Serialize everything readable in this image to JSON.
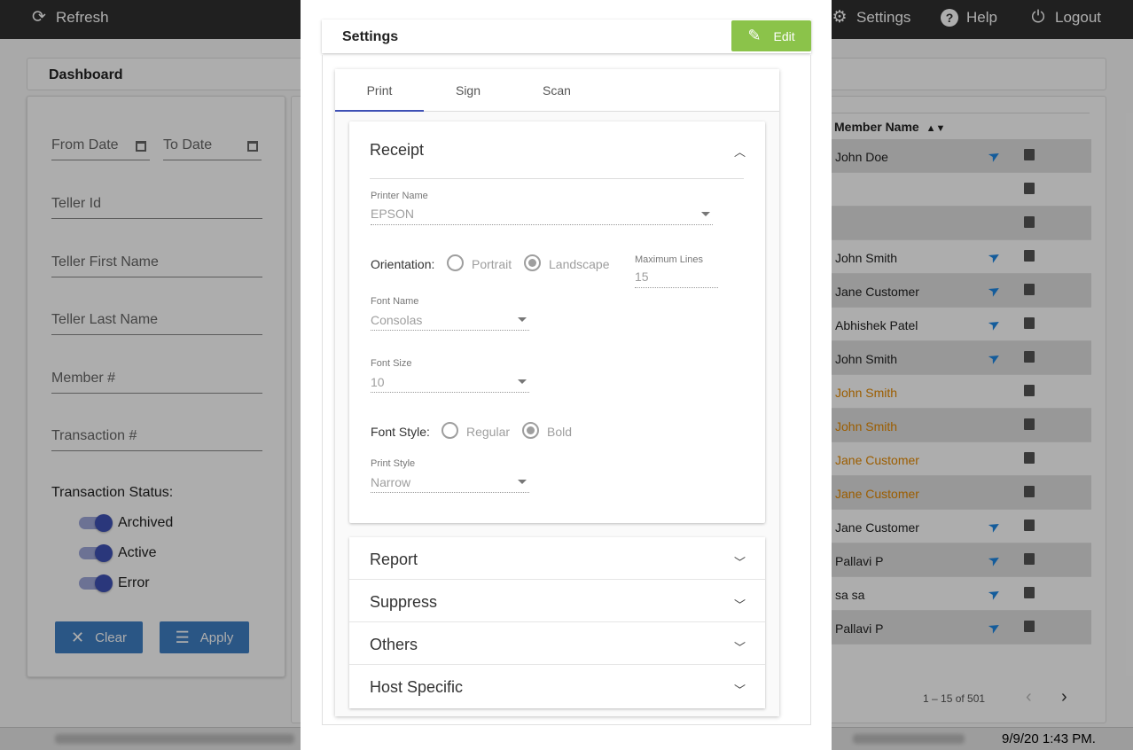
{
  "topbar": {
    "refresh": "Refresh",
    "settings": "Settings",
    "help": "Help",
    "logout": "Logout"
  },
  "dashboard": {
    "title": "Dashboard"
  },
  "filters": {
    "from_date": "From Date",
    "to_date": "To Date",
    "teller_id": "Teller Id",
    "teller_first_name": "Teller First Name",
    "teller_last_name": "Teller Last Name",
    "member_no": "Member #",
    "transaction_no": "Transaction #",
    "status_title": "Transaction Status:",
    "statuses": [
      "Archived",
      "Active",
      "Error"
    ],
    "clear": "Clear",
    "apply": "Apply"
  },
  "table": {
    "member_name_header": "Member Name",
    "rows": [
      {
        "name": "John Doe",
        "send": true,
        "warn": false
      },
      {
        "name": "",
        "send": false,
        "warn": false
      },
      {
        "name": "",
        "send": false,
        "warn": false
      },
      {
        "name": "John Smith",
        "send": true,
        "warn": false
      },
      {
        "name": "Jane Customer",
        "send": true,
        "warn": false
      },
      {
        "name": "Abhishek Patel",
        "send": true,
        "warn": false
      },
      {
        "name": "John Smith",
        "send": true,
        "warn": false
      },
      {
        "name": "John Smith",
        "send": false,
        "warn": true
      },
      {
        "name": "John Smith",
        "send": false,
        "warn": true
      },
      {
        "name": "Jane Customer",
        "send": false,
        "warn": true
      },
      {
        "name": "Jane Customer",
        "send": false,
        "warn": true
      },
      {
        "name": "Jane Customer",
        "send": true,
        "warn": false
      },
      {
        "name": "Pallavi P",
        "send": true,
        "warn": false
      },
      {
        "name": "sa sa",
        "send": true,
        "warn": false
      },
      {
        "name": "Pallavi P",
        "send": true,
        "warn": false
      }
    ],
    "paginator": "1 – 15 of 501"
  },
  "footer": {
    "timestamp": "9/9/20 1:43 PM."
  },
  "modal": {
    "title": "Settings",
    "edit": "Edit",
    "tabs": [
      "Print",
      "Sign",
      "Scan"
    ],
    "receipt": {
      "title": "Receipt",
      "printer_name_label": "Printer Name",
      "printer_name": "EPSON",
      "orientation_label": "Orientation:",
      "orientation_options": [
        "Portrait",
        "Landscape"
      ],
      "orientation_selected": "Landscape",
      "max_lines_label": "Maximum Lines",
      "max_lines": "15",
      "font_name_label": "Font Name",
      "font_name": "Consolas",
      "font_size_label": "Font Size",
      "font_size": "10",
      "font_style_label": "Font Style:",
      "font_style_options": [
        "Regular",
        "Bold"
      ],
      "font_style_selected": "Bold",
      "print_style_label": "Print Style",
      "print_style": "Narrow"
    },
    "sections": [
      "Report",
      "Suppress",
      "Others",
      "Host Specific"
    ]
  },
  "colors": {
    "accent": "#3f51b5",
    "edit": "#8bc34a",
    "warn": "#e68a00",
    "send": "#1e88e5"
  }
}
